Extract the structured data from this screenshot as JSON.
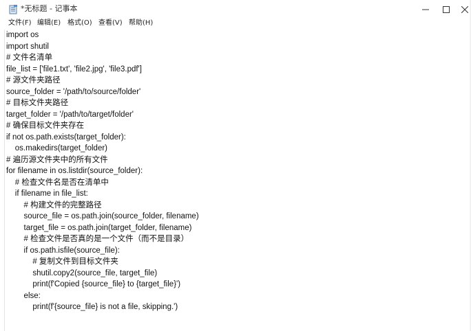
{
  "window": {
    "title": "*无标题 - 记事本",
    "minimize_label": "—",
    "maximize_label": "☐",
    "close_label": "✕"
  },
  "menu": [
    {
      "label": "文件(F)"
    },
    {
      "label": "编辑(E)"
    },
    {
      "label": "格式(O)"
    },
    {
      "label": "查看(V)"
    },
    {
      "label": "帮助(H)"
    }
  ],
  "editor": {
    "lines": [
      "import os",
      "import shutil",
      "# 文件名清单",
      "file_list = ['file1.txt', 'file2.jpg', 'file3.pdf']",
      "# 源文件夹路径",
      "source_folder = '/path/to/source/folder'",
      "# 目标文件夹路径",
      "target_folder = '/path/to/target/folder'",
      "# 确保目标文件夹存在",
      "if not os.path.exists(target_folder):",
      "    os.makedirs(target_folder)",
      "# 遍历源文件夹中的所有文件",
      "for filename in os.listdir(source_folder):",
      "    # 检查文件名是否在清单中",
      "    if filename in file_list:",
      "        # 构建文件的完整路径",
      "        source_file = os.path.join(source_folder, filename)",
      "        target_file = os.path.join(target_folder, filename)",
      "        # 检查文件是否真的是一个文件（而不是目录）",
      "        if os.path.isfile(source_file):",
      "            # 复制文件到目标文件夹",
      "            shutil.copy2(source_file, target_file)",
      "            print(f'Copied {source_file} to {target_file}')",
      "        else:",
      "            print(f'{source_file} is not a file, skipping.')"
    ]
  }
}
